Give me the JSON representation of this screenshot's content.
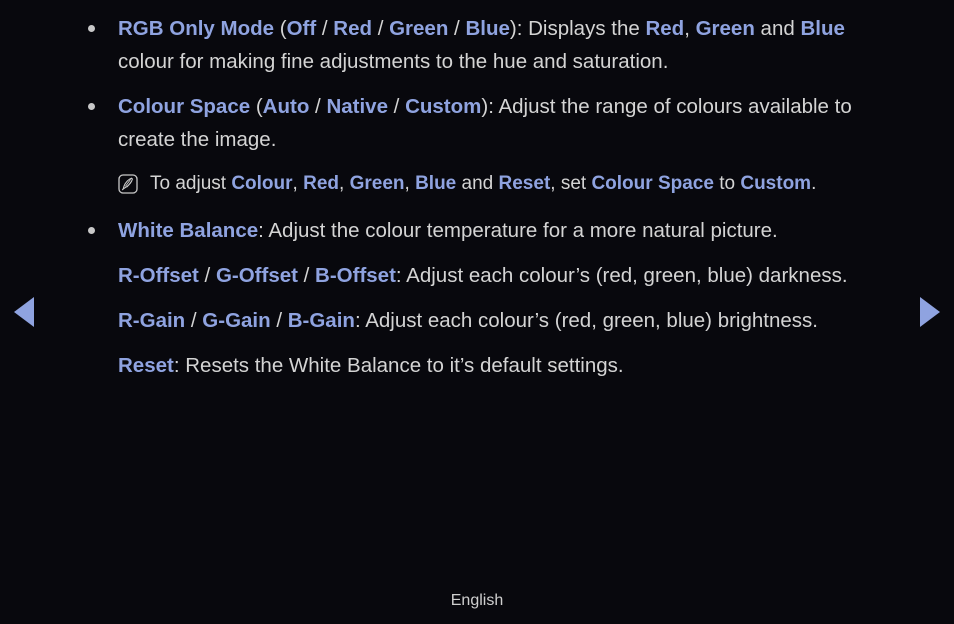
{
  "page": {
    "background_color": "#08080d",
    "highlight_color": "#8fa3e0",
    "body_text_color": "#d4d4d4"
  },
  "nav": {
    "prev_label": "◀",
    "prev_icon": "triangle-left-icon",
    "next_label": "▶",
    "next_icon": "triangle-right-icon"
  },
  "content": {
    "bullet1": {
      "term": "RGB Only Mode",
      "paren_open": " (",
      "opt1": "Off",
      "sep1": " / ",
      "opt2": "Red",
      "sep2": " / ",
      "opt3": "Green",
      "sep3": " / ",
      "opt4": "Blue",
      "paren_close": "): Displays the ",
      "t1": "Red",
      "comma1": ", ",
      "t2": "Green",
      "and1": " and ",
      "t3": "Blue",
      "tail": " colour for making fine adjustments to the hue and saturation."
    },
    "bullet2": {
      "term": "Colour Space",
      "paren_open": " (",
      "opt1": "Auto",
      "sep1": " / ",
      "opt2": "Native",
      "sep2": " / ",
      "opt3": "Custom",
      "paren_close": "): Adjust the range of colours available to create the image."
    },
    "note": {
      "icon": "note-pen-icon",
      "lead": "To adjust ",
      "t1": "Colour",
      "c1": ", ",
      "t2": "Red",
      "c2": ", ",
      "t3": "Green",
      "c3": ", ",
      "t4": "Blue",
      "and1": " and ",
      "t5": "Reset",
      "mid": ", set ",
      "t6": "Colour Space",
      "to": " to ",
      "t7": "Custom",
      "end": "."
    },
    "bullet3": {
      "term": "White Balance",
      "desc": ": Adjust the colour temperature for a more natural picture."
    },
    "para_offset": {
      "t1": "R-Offset",
      "s1": " / ",
      "t2": "G-Offset",
      "s2": " / ",
      "t3": "B-Offset",
      "desc": ": Adjust each colour’s (red, green, blue) darkness."
    },
    "para_gain": {
      "t1": "R-Gain",
      "s1": " / ",
      "t2": "G-Gain",
      "s2": " / ",
      "t3": "B-Gain",
      "desc": ": Adjust each colour’s (red, green, blue) brightness."
    },
    "para_reset": {
      "t1": "Reset",
      "desc": ": Resets the White Balance to it’s default settings."
    }
  },
  "footer": {
    "language": "English"
  }
}
